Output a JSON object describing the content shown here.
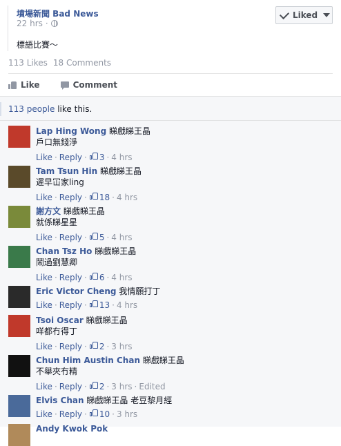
{
  "post": {
    "page_name": "墳場新聞 Bad News",
    "time": "22 hrs",
    "privacy_separator": "·",
    "liked_button": "Liked",
    "text": "標語比賽～",
    "likes_count": "113 Likes",
    "comments_count": "18 Comments",
    "like_action": "Like",
    "comment_action": "Comment"
  },
  "likes_summary": {
    "people": "113 people",
    "suffix": " like this."
  },
  "labels": {
    "like": "Like",
    "reply": "Reply",
    "dot": "·"
  },
  "comments": [
    {
      "author": "Lap Hing Wong",
      "tag": "睇戲睇王晶",
      "text": "戶口無錢淨",
      "likes": "3",
      "time": "4 hrs",
      "edited": "",
      "avatar_color": "#c0392b"
    },
    {
      "author": "Tam Tsun Hin",
      "tag": "睇戲睇王晶",
      "text": "遲早冚家ling",
      "likes": "18",
      "time": "4 hrs",
      "edited": "",
      "avatar_color": "#5a4a2a"
    },
    {
      "author": "謝方文",
      "tag": "睇戲睇王晶",
      "text": "就係睇星星",
      "likes": "5",
      "time": "4 hrs",
      "edited": "",
      "avatar_color": "#7a8a3a"
    },
    {
      "author": "Chan Tsz Ho",
      "tag": "睇戲睇王晶",
      "text": "鬧過劉慧卿",
      "likes": "6",
      "time": "4 hrs",
      "edited": "",
      "avatar_color": "#3a7a4a"
    },
    {
      "author": "Eric Victor Cheng",
      "tag": "我情願打丁",
      "text": "",
      "likes": "13",
      "time": "4 hrs",
      "edited": "",
      "avatar_color": "#2a2a2a"
    },
    {
      "author": "Tsoi Oscar",
      "tag": "睇戲睇王晶",
      "text": "咩都冇得丁",
      "likes": "2",
      "time": "3 hrs",
      "edited": "",
      "avatar_color": "#c0392b"
    },
    {
      "author": "Chun Him Austin Chan",
      "tag": "睇戲睇王晶",
      "text": "不舉夾冇精",
      "likes": "2",
      "time": "3 hrs",
      "edited": "Edited",
      "avatar_color": "#111111"
    },
    {
      "author": "Elvis Chan",
      "tag": "睇戲睇王晶 老豆黎月經",
      "text": "",
      "likes": "10",
      "time": "3 hrs",
      "edited": "",
      "avatar_color": "#4a6a9a"
    }
  ],
  "partial_author": "Andy Kwok Pok"
}
